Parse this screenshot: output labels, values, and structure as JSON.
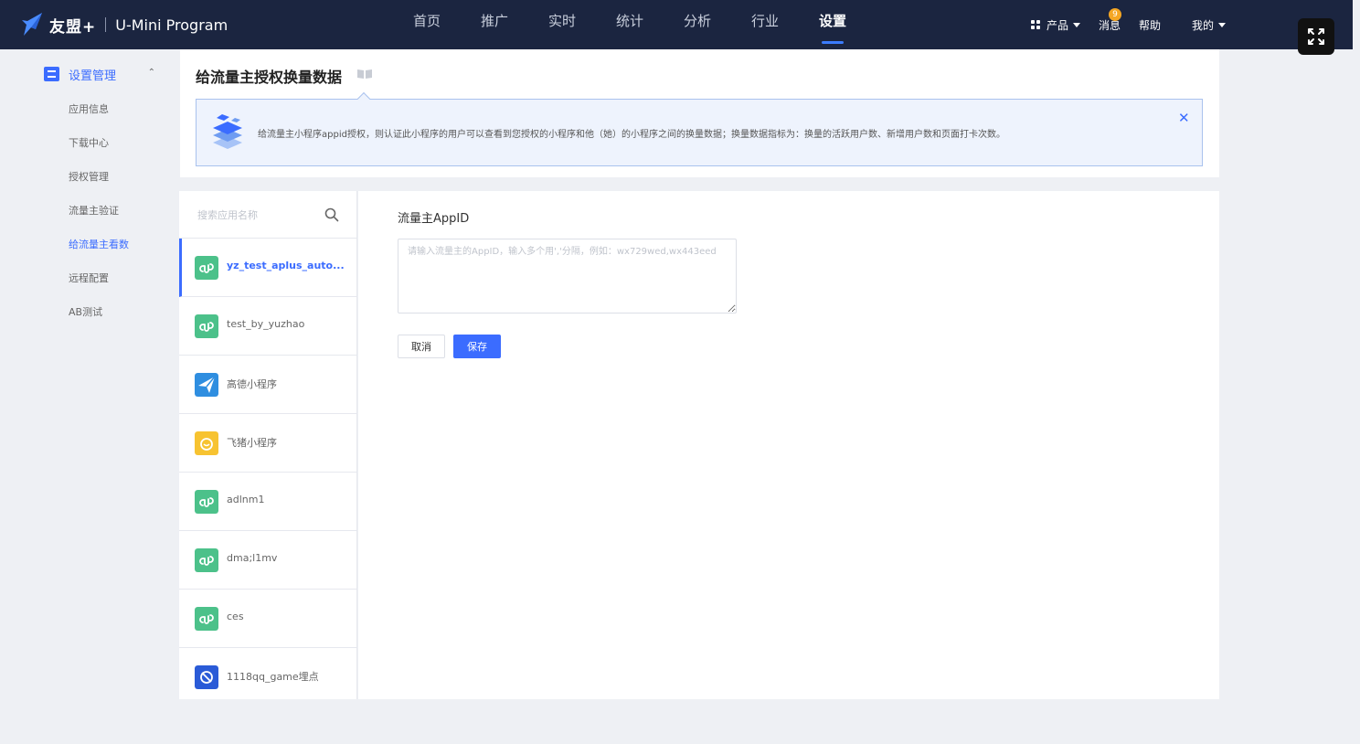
{
  "brand": {
    "name": "友盟+",
    "product": "U-Mini Program"
  },
  "nav": {
    "items": [
      "首页",
      "推广",
      "实时",
      "统计",
      "分析",
      "行业",
      "设置"
    ],
    "active_index": 6
  },
  "top_right": {
    "products": "产品",
    "messages": "消息",
    "message_count": "9",
    "help": "帮助",
    "mine": "我的"
  },
  "sidebar": {
    "section": "设置管理",
    "items": [
      "应用信息",
      "下载中心",
      "授权管理",
      "流量主验证",
      "给流量主看数",
      "远程配置",
      "AB测试"
    ],
    "active_index": 4
  },
  "page": {
    "title": "给流量主授权换量数据",
    "notice": "给流量主小程序appid授权，则认证此小程序的用户可以查看到您授权的小程序和他（她）的小程序之间的换量数据；换量数据指标为：换量的活跃用户数、新增用户数和页面打卡次数。"
  },
  "search": {
    "placeholder": "搜索应用名称"
  },
  "apps": [
    {
      "name": "yz_test_aplus_auto...",
      "icon": "link-icon",
      "color": "#4cc18a"
    },
    {
      "name": "test_by_yuzhao",
      "icon": "link-icon",
      "color": "#4cc18a"
    },
    {
      "name": "高德小程序",
      "icon": "amap-icon",
      "color": "#2f8ee0"
    },
    {
      "name": "飞猪小程序",
      "icon": "fliggy-icon",
      "color": "#f7c331"
    },
    {
      "name": "adlnm1",
      "icon": "link-icon",
      "color": "#4cc18a"
    },
    {
      "name": "dma;l1mv",
      "icon": "link-icon",
      "color": "#4cc18a"
    },
    {
      "name": "ces",
      "icon": "link-icon",
      "color": "#4cc18a"
    },
    {
      "name": "1118qq_game埋点",
      "icon": "game-icon",
      "color": "#2a5bd7"
    }
  ],
  "form": {
    "label": "流量主AppID",
    "placeholder": "请输入流量主的AppID，输入多个用','分隔，例如：wx729wed,wx443eed",
    "cancel": "取消",
    "save": "保存"
  },
  "colors": {
    "accent": "#3b6cff",
    "topbar": "#1b2540"
  }
}
